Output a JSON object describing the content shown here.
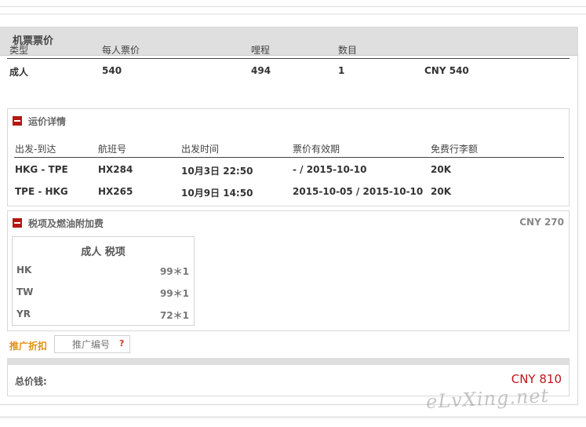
{
  "panel": {
    "title": "机票票价"
  },
  "fare": {
    "headers": [
      "类型",
      "每人票价",
      "哩程",
      "数目"
    ],
    "row": {
      "type": "成人",
      "price": "540",
      "miles": "494",
      "count": "1",
      "subtotal": "CNY 540"
    }
  },
  "fare_details": {
    "title": "运价详情",
    "headers": [
      "出发-到达",
      "航班号",
      "出发时间",
      "票价有效期",
      "免费行李额"
    ],
    "rows": [
      {
        "route": "HKG - TPE",
        "flight": "HX284",
        "depart": "10月3日 22:50",
        "validity": "- / 2015-10-10",
        "baggage": "20K"
      },
      {
        "route": "TPE - HKG",
        "flight": "HX265",
        "depart": "10月9日 14:50",
        "validity": "2015-10-05 / 2015-10-10",
        "baggage": "20K"
      }
    ]
  },
  "taxes": {
    "title": "税项及燃油附加费",
    "total": "CNY 270",
    "table_title": "成人 税项",
    "items": [
      {
        "code": "HK",
        "value": "99＊1"
      },
      {
        "code": "TW",
        "value": "99＊1"
      },
      {
        "code": "YR",
        "value": "72＊1"
      }
    ]
  },
  "promo": {
    "label": "推广折扣",
    "placeholder": "推广编号",
    "help": "?"
  },
  "total": {
    "label": "总价钱:",
    "value": "CNY 810"
  },
  "watermark": "eLvXing.net",
  "colors": {
    "accent_red": "#c0141b",
    "promo_orange": "#e09012",
    "header_gray": "#dfdfdf",
    "minus_icon_red": "#b51616"
  },
  "icons": {
    "collapse": "minus-square-icon"
  }
}
